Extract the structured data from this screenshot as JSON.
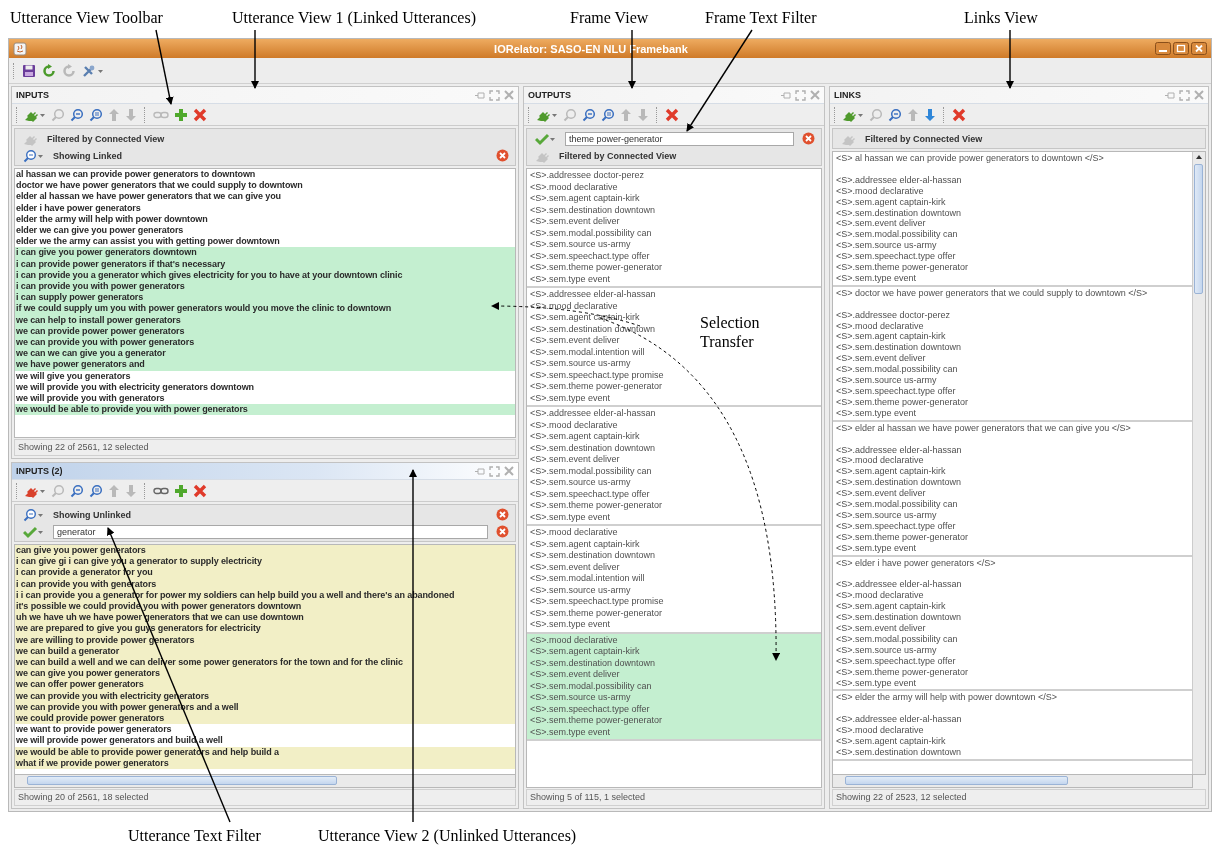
{
  "callouts": [
    {
      "text": "Utterance View Toolbar"
    },
    {
      "text": "Utterance View 1 (Linked Utterances)"
    },
    {
      "text": "Frame View"
    },
    {
      "text": "Frame Text Filter"
    },
    {
      "text": "Links View"
    },
    {
      "text": "Selection Transfer"
    },
    {
      "text": "Utterance Text Filter"
    },
    {
      "text": "Utterance View 2 (Unlinked Utterances)"
    }
  ],
  "window": {
    "title": "IORelator: SASO-EN NLU Framebank"
  },
  "toolbar": [
    {
      "kind": "save",
      "disabled": false
    },
    {
      "kind": "refresh",
      "disabled": false
    },
    {
      "kind": "redo",
      "disabled": true
    },
    {
      "kind": "tools",
      "disabled": false
    }
  ],
  "views": [
    {
      "kind": "inputs",
      "title": "INPUTS",
      "active": false,
      "color": "#c4efd0",
      "toolbar": [
        {
          "kind": "plug",
          "on": true
        },
        {
          "kind": "zoom",
          "disabled": true
        },
        {
          "kind": "zoom-out",
          "disabled": false
        },
        {
          "kind": "zoom-fit",
          "disabled": false
        },
        {
          "kind": "up",
          "disabled": true
        },
        {
          "kind": "down",
          "disabled": true
        },
        {
          "kind": "separator"
        },
        {
          "kind": "link",
          "disabled": true
        },
        {
          "kind": "add",
          "disabled": false
        },
        {
          "kind": "delete",
          "disabled": false
        }
      ],
      "filters": [
        {
          "kind": "connected",
          "text": "Filtered by Connected View"
        },
        {
          "kind": "showing",
          "text": "Showing Linked"
        }
      ],
      "rows": [
        {
          "text": "al hassan we can provide power generators to downtown",
          "selected": false
        },
        {
          "text": "doctor we have power generators that we could supply to downtown",
          "selected": false
        },
        {
          "text": "elder al hassan we have power generators that we can give you",
          "selected": false
        },
        {
          "text": "elder i have power generators",
          "selected": false
        },
        {
          "text": "elder the army will help with power downtown",
          "selected": false
        },
        {
          "text": "elder we can give you power generators",
          "selected": false
        },
        {
          "text": "elder we the army can assist you with getting power downtown",
          "selected": false
        },
        {
          "text": "i can give you power generators downtown",
          "selected": true
        },
        {
          "text": "i can provide power generators if that's necessary",
          "selected": true
        },
        {
          "text": "i can provide you a generator which gives electricity for you to have at your downtown clinic",
          "selected": true
        },
        {
          "text": "i can provide you with power generators",
          "selected": true
        },
        {
          "text": "i can supply power generators",
          "selected": true
        },
        {
          "text": "if we could supply um you with power generators would you move the clinic to downtown",
          "selected": true
        },
        {
          "text": "we can help to install power generators",
          "selected": true
        },
        {
          "text": "we can provide power power generators",
          "selected": true
        },
        {
          "text": "we can provide you with power generators",
          "selected": true
        },
        {
          "text": "we can we can give you a generator",
          "selected": true
        },
        {
          "text": "we have power generators and",
          "selected": true
        },
        {
          "text": "we will give you generators",
          "selected": false
        },
        {
          "text": "we will provide you with electricity generators downtown",
          "selected": false
        },
        {
          "text": "we will provide you with generators",
          "selected": false
        },
        {
          "text": "we would be able to provide you with power generators",
          "selected": true
        }
      ],
      "status": "Showing 22 of 2561, 12 selected"
    },
    {
      "kind": "inputs",
      "title": "INPUTS (2)",
      "active": true,
      "color": "#f2efc6",
      "hscroll": true,
      "toolbar": [
        {
          "kind": "plug",
          "on": false
        },
        {
          "kind": "zoom",
          "disabled": true
        },
        {
          "kind": "zoom-out",
          "disabled": false
        },
        {
          "kind": "zoom-fit",
          "disabled": false
        },
        {
          "kind": "up",
          "disabled": true
        },
        {
          "kind": "down",
          "disabled": true
        },
        {
          "kind": "separator"
        },
        {
          "kind": "link",
          "disabled": false
        },
        {
          "kind": "add",
          "disabled": false
        },
        {
          "kind": "delete",
          "disabled": false
        }
      ],
      "filters": [
        {
          "kind": "showing",
          "text": "Showing Unlinked"
        },
        {
          "kind": "text",
          "value": "generator"
        }
      ],
      "rows": [
        {
          "text": "can give you power generators",
          "selected": true
        },
        {
          "text": "i can give gi i can give you a generator to supply electricity",
          "selected": true
        },
        {
          "text": "i can provide a generator for you",
          "selected": true
        },
        {
          "text": "i can provide you with generators",
          "selected": true
        },
        {
          "text": "i i can provide you a generator for power my soldiers can help build you a well and there's an abandoned",
          "selected": true
        },
        {
          "text": "it's possible we could provide you with power generators downtown",
          "selected": true
        },
        {
          "text": "uh we have uh we have power generators that we can use downtown",
          "selected": true
        },
        {
          "text": "we are prepared to give you guys generators for electricity",
          "selected": true
        },
        {
          "text": "we are willing to provide power generators",
          "selected": true
        },
        {
          "text": "we can build a generator",
          "selected": true
        },
        {
          "text": "we can build a well and we can deliver some power generators for the town and for the clinic",
          "selected": true
        },
        {
          "text": "we can give you power generators",
          "selected": true
        },
        {
          "text": "we can offer power generators",
          "selected": true
        },
        {
          "text": "we can provide you with electricity generators",
          "selected": true
        },
        {
          "text": "we can provide you with power generators and a well",
          "selected": true
        },
        {
          "text": "we could provide power generators",
          "selected": true
        },
        {
          "text": "we want to provide power generators",
          "selected": false
        },
        {
          "text": "we will provide power generators and build a well",
          "selected": false
        },
        {
          "text": "we would be able to provide power generators and help build a",
          "selected": true
        },
        {
          "text": "what if we provide power generators",
          "selected": true
        }
      ],
      "status": "Showing 20 of 2561, 18 selected"
    },
    {
      "kind": "outputs",
      "title": "OUTPUTS",
      "active": false,
      "toolbar": [
        {
          "kind": "plug",
          "on": true
        },
        {
          "kind": "zoom",
          "disabled": true
        },
        {
          "kind": "zoom-out",
          "disabled": false
        },
        {
          "kind": "zoom-fit",
          "disabled": false
        },
        {
          "kind": "up",
          "disabled": true
        },
        {
          "kind": "down",
          "disabled": true
        },
        {
          "kind": "separator"
        },
        {
          "kind": "delete",
          "disabled": false
        }
      ],
      "filters": [
        {
          "kind": "text",
          "value": "theme power-generator"
        },
        {
          "kind": "connected",
          "text": "Filtered by Connected View"
        }
      ],
      "frames": [
        {
          "selected": false,
          "lines": [
            "<S>.addressee doctor-perez",
            "<S>.mood declarative",
            "<S>.sem.agent captain-kirk",
            "<S>.sem.destination downtown",
            "<S>.sem.event deliver",
            "<S>.sem.modal.possibility can",
            "<S>.sem.source us-army",
            "<S>.sem.speechact.type offer",
            "<S>.sem.theme power-generator",
            "<S>.sem.type event"
          ]
        },
        {
          "selected": false,
          "lines": [
            "<S>.addressee elder-al-hassan",
            "<S>.mood declarative",
            "<S>.sem.agent captain-kirk",
            "<S>.sem.destination downtown",
            "<S>.sem.event deliver",
            "<S>.sem.modal.intention will",
            "<S>.sem.source us-army",
            "<S>.sem.speechact.type promise",
            "<S>.sem.theme power-generator",
            "<S>.sem.type event"
          ]
        },
        {
          "selected": false,
          "lines": [
            "<S>.addressee elder-al-hassan",
            "<S>.mood declarative",
            "<S>.sem.agent captain-kirk",
            "<S>.sem.destination downtown",
            "<S>.sem.event deliver",
            "<S>.sem.modal.possibility can",
            "<S>.sem.source us-army",
            "<S>.sem.speechact.type offer",
            "<S>.sem.theme power-generator",
            "<S>.sem.type event"
          ]
        },
        {
          "selected": false,
          "lines": [
            "<S>.mood declarative",
            "<S>.sem.agent captain-kirk",
            "<S>.sem.destination downtown",
            "<S>.sem.event deliver",
            "<S>.sem.modal.intention will",
            "<S>.sem.source us-army",
            "<S>.sem.speechact.type promise",
            "<S>.sem.theme power-generator",
            "<S>.sem.type event"
          ]
        },
        {
          "selected": true,
          "lines": [
            "<S>.mood declarative",
            "<S>.sem.agent captain-kirk",
            "<S>.sem.destination downtown",
            "<S>.sem.event deliver",
            "<S>.sem.modal.possibility can",
            "<S>.sem.source us-army",
            "<S>.sem.speechact.type offer",
            "<S>.sem.theme power-generator",
            "<S>.sem.type event"
          ]
        }
      ],
      "status": "Showing 5 of 115, 1 selected"
    },
    {
      "kind": "links",
      "title": "LINKS",
      "active": false,
      "hscroll": true,
      "vscroll": true,
      "toolbar": [
        {
          "kind": "plug",
          "on": true
        },
        {
          "kind": "zoom",
          "disabled": true
        },
        {
          "kind": "zoom-out",
          "disabled": false
        },
        {
          "kind": "up",
          "disabled": true
        },
        {
          "kind": "down",
          "disabled": false
        },
        {
          "kind": "separator"
        },
        {
          "kind": "delete",
          "disabled": false
        }
      ],
      "filters": [
        {
          "kind": "connected",
          "text": "Filtered by Connected View"
        }
      ],
      "links": [
        {
          "utterance": "<S> al hassan we can provide power generators to downtown </S>",
          "lines": [
            "<S>.addressee elder-al-hassan",
            "<S>.mood declarative",
            "<S>.sem.agent captain-kirk",
            "<S>.sem.destination downtown",
            "<S>.sem.event deliver",
            "<S>.sem.modal.possibility can",
            "<S>.sem.source us-army",
            "<S>.sem.speechact.type offer",
            "<S>.sem.theme power-generator",
            "<S>.sem.type event"
          ]
        },
        {
          "utterance": "<S> doctor we have power generators that we could supply to downtown </S>",
          "lines": [
            "<S>.addressee doctor-perez",
            "<S>.mood declarative",
            "<S>.sem.agent captain-kirk",
            "<S>.sem.destination downtown",
            "<S>.sem.event deliver",
            "<S>.sem.modal.possibility can",
            "<S>.sem.source us-army",
            "<S>.sem.speechact.type offer",
            "<S>.sem.theme power-generator",
            "<S>.sem.type event"
          ]
        },
        {
          "utterance": "<S> elder al hassan we have power generators that we can give you </S>",
          "lines": [
            "<S>.addressee elder-al-hassan",
            "<S>.mood declarative",
            "<S>.sem.agent captain-kirk",
            "<S>.sem.destination downtown",
            "<S>.sem.event deliver",
            "<S>.sem.modal.possibility can",
            "<S>.sem.source us-army",
            "<S>.sem.speechact.type offer",
            "<S>.sem.theme power-generator",
            "<S>.sem.type event"
          ]
        },
        {
          "utterance": "<S> elder i have power generators </S>",
          "lines": [
            "<S>.addressee elder-al-hassan",
            "<S>.mood declarative",
            "<S>.sem.agent captain-kirk",
            "<S>.sem.destination downtown",
            "<S>.sem.event deliver",
            "<S>.sem.modal.possibility can",
            "<S>.sem.source us-army",
            "<S>.sem.speechact.type offer",
            "<S>.sem.theme power-generator",
            "<S>.sem.type event"
          ]
        },
        {
          "utterance": "<S> elder the army will help with power downtown </S>",
          "lines": [
            "<S>.addressee elder-al-hassan",
            "<S>.mood declarative",
            "<S>.sem.agent captain-kirk",
            "<S>.sem.destination downtown"
          ]
        }
      ],
      "status": "Showing 22 of 2523, 12 selected"
    }
  ]
}
